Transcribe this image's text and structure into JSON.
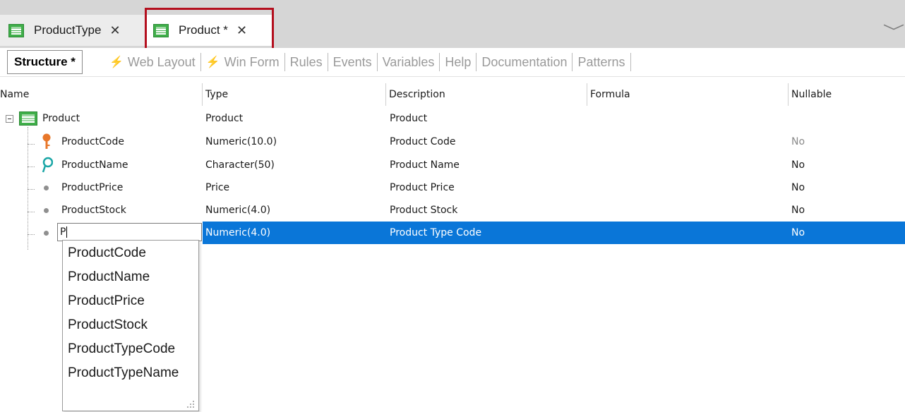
{
  "tabs": [
    {
      "label": "ProductType",
      "close": "✕"
    },
    {
      "label": "Product *",
      "close": "✕"
    }
  ],
  "tab_overflow": "﹀",
  "subtabs": {
    "active": "Structure *",
    "items": [
      "Web Layout",
      "Win Form",
      "Rules",
      "Events",
      "Variables",
      "Help",
      "Documentation",
      "Patterns"
    ]
  },
  "grid": {
    "headers": [
      "Name",
      "Type",
      "Description",
      "Formula",
      "Nullable"
    ],
    "rows": [
      {
        "name": "Product",
        "type": "Product",
        "description": "Product",
        "formula": "",
        "nullable": "",
        "icon": "transaction-icon"
      },
      {
        "name": "ProductCode",
        "type": "Numeric(10.0)",
        "description": "Product Code",
        "formula": "",
        "nullable": "No",
        "icon": "primary-key-icon"
      },
      {
        "name": "ProductName",
        "type": "Character(50)",
        "description": "Product Name",
        "formula": "",
        "nullable": "No",
        "icon": "search-key-icon"
      },
      {
        "name": "ProductPrice",
        "type": "Price",
        "description": "Product Price",
        "formula": "",
        "nullable": "No",
        "icon": "attribute-dot-icon"
      },
      {
        "name": "ProductStock",
        "type": "Numeric(4.0)",
        "description": "Product Stock",
        "formula": "",
        "nullable": "No",
        "icon": "attribute-dot-icon"
      },
      {
        "name": "P",
        "type": "Numeric(4.0)",
        "description": "Product Type Code",
        "formula": "",
        "nullable": "No",
        "icon": "attribute-dot-icon"
      }
    ]
  },
  "autocomplete": [
    "ProductCode",
    "ProductName",
    "ProductPrice",
    "ProductStock",
    "ProductTypeCode",
    "ProductTypeName"
  ],
  "colors": {
    "selection": "#0a76d8",
    "highlight_border": "#b40f1e",
    "primary_key": "#e8772a",
    "search_key": "#1ba6a6"
  }
}
